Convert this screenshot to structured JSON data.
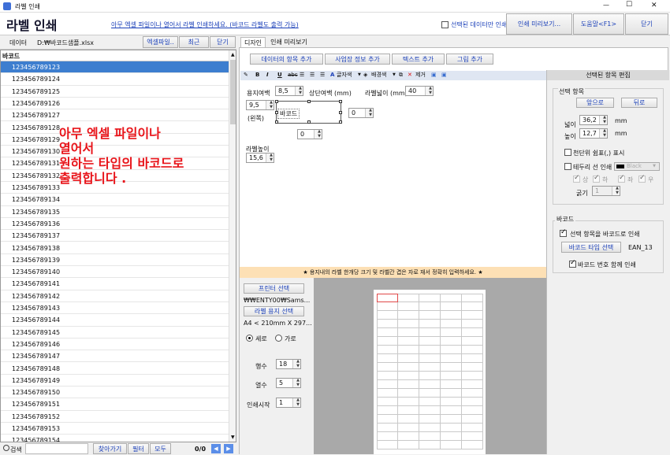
{
  "window": {
    "title": "라벨 인쇄",
    "minimize": "—",
    "maximize": "☐",
    "close": "✕"
  },
  "header": {
    "app_title": "라벨 인쇄",
    "notice": "아무 엑셀 파일이나 열어서 라벨 인쇄하세요. (바코드 라벨도 출력 가능)",
    "selected_only_label": "선택된 데이터만 인쇄",
    "print_preview_button": "인쇄 미리보기...",
    "help_button": "도움말<F1>",
    "close_button": "닫기"
  },
  "left": {
    "data_label": "데이터",
    "file_path": "D:₩바코드샘플.xlsx",
    "excel_button": "엑셀파일..",
    "recent_button": "최근",
    "close_button": "닫기",
    "column_header": "바코드",
    "rows": [
      "123456789123",
      "123456789124",
      "123456789125",
      "123456789126",
      "123456789127",
      "123456789128",
      "123456789129",
      "123456789130",
      "123456789131",
      "123456789132",
      "123456789133",
      "123456789134",
      "123456789135",
      "123456789136",
      "123456789137",
      "123456789138",
      "123456789139",
      "123456789140",
      "123456789141",
      "123456789142",
      "123456789143",
      "123456789144",
      "123456789145",
      "123456789146",
      "123456789147",
      "123456789148",
      "123456789149",
      "123456789150",
      "123456789151",
      "123456789152",
      "123456789153",
      "123456789154"
    ],
    "overlay_lines": [
      "아무 엑셀 파일이나",
      "열어서",
      "원하는 타입의 바코드로",
      "출력합니다 ."
    ],
    "search_label": "검색",
    "find_button": "찾아가기",
    "filter_button": "필터",
    "all_button": "모두",
    "page_count": "0/0"
  },
  "tabs": {
    "design": "디자인",
    "preview": "인쇄 미리보기"
  },
  "design": {
    "add_item_button": "데이터의 항목 추가",
    "add_business_button": "사업장 정보 추가",
    "add_text_button": "텍스트 추가",
    "add_image_button": "그림 추가",
    "toolbar": {
      "bold": "B",
      "italic": "I",
      "underline": "U",
      "strike": "abc",
      "font_button": "글자색",
      "bg_button": "배경색",
      "delete_button": "제거"
    },
    "paper_margin_label": "용지여백",
    "paper_margin_value": "8,5",
    "top_margin_label": "상단여백 (mm)",
    "label_width_label": "라벨넓이 (mm)",
    "label_width_value": "40",
    "left_margin_value": "9,5",
    "left_label": "(왼쪽)",
    "barcode_text": "바코드",
    "h_gap_value": "0",
    "v_gap_value": "0",
    "label_height_label": "라벨높이",
    "label_height_value": "15,6"
  },
  "notice_bar": "★ 용지내의 라벨 한개당 크기 및 라벨간 겹은 자로 재서 정확히 입력하세요. ★",
  "printer": {
    "printer_button": "프린터 선택",
    "printer_name": "₩₩ENTY00₩Sams...",
    "paper_button": "라벨 용지 선택",
    "paper_size": "A4 < 210mm X 297...",
    "portrait": "세로",
    "landscape": "가로",
    "rows_label": "행수",
    "rows_value": "18",
    "cols_label": "열수",
    "cols_value": "5",
    "start_label": "인쇄시작",
    "start_value": "1"
  },
  "right": {
    "title": "선택된 항목 편집",
    "group_selection": "선택 항목",
    "front_button": "앞으로",
    "back_button": "뒤로",
    "width_label": "넓이",
    "width_value": "36,2",
    "height_label": "높이",
    "height_value": "12,7",
    "unit": "mm",
    "thousand_sep": "천단위 쉼표(,) 표시",
    "border_print": "테두리 선 인쇄",
    "color_value": "Black",
    "top": "상",
    "bottom": "하",
    "left": "좌",
    "right": "우",
    "thickness_label": "굵기",
    "thickness_value": "1",
    "group_barcode": "바코드",
    "print_as_barcode": "선택 항목을 바코드로 인쇄",
    "barcode_type_button": "바코드 타입 선택",
    "barcode_type": "EAN_13",
    "print_with_number": "바코드 번호 함께 인쇄"
  },
  "preview_grid": {
    "rows": 18,
    "cols": 5
  }
}
